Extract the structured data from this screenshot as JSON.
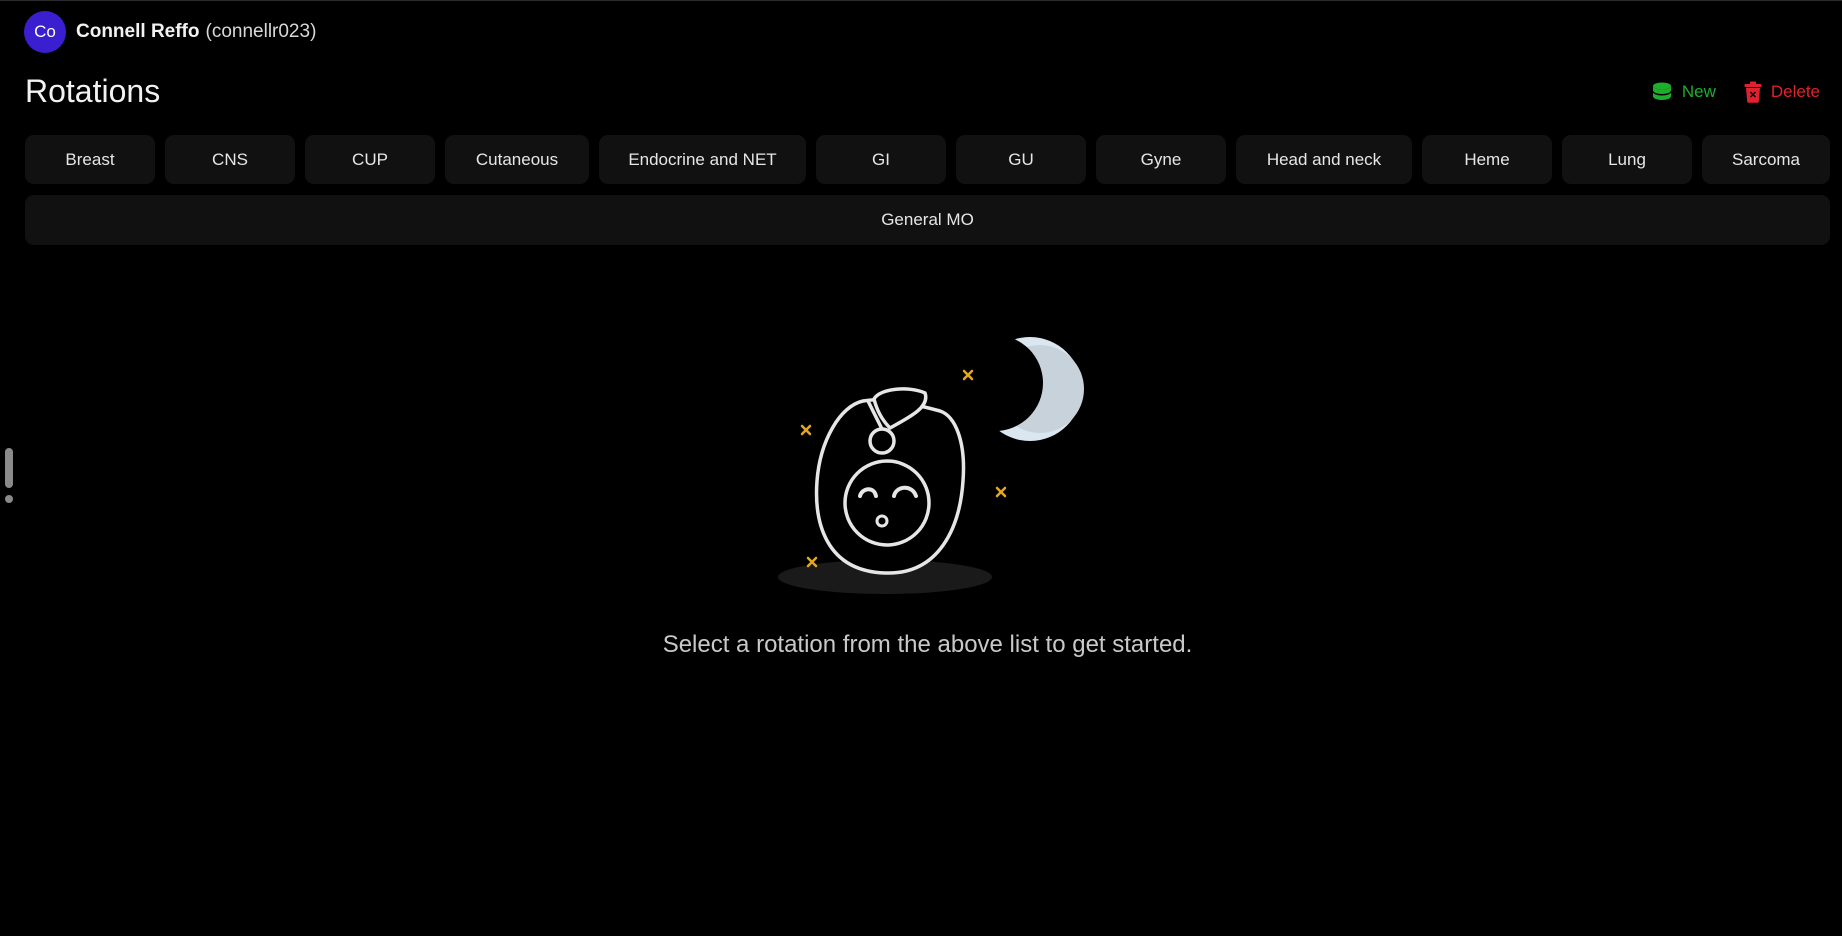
{
  "user": {
    "avatar_initials": "Co",
    "name": "Connell Reffo",
    "handle": "(connellr023)"
  },
  "page": {
    "title": "Rotations"
  },
  "actions": {
    "new_label": "New",
    "delete_label": "Delete",
    "new_icon": "database-icon",
    "delete_icon": "trash-icon"
  },
  "tabs": [
    {
      "label": "Breast"
    },
    {
      "label": "CNS"
    },
    {
      "label": "CUP"
    },
    {
      "label": "Cutaneous"
    },
    {
      "label": "Endocrine and NET"
    },
    {
      "label": "GI"
    },
    {
      "label": "GU"
    },
    {
      "label": "Gyne"
    },
    {
      "label": "Head and neck"
    },
    {
      "label": "Heme"
    },
    {
      "label": "Lung"
    },
    {
      "label": "Sarcoma"
    }
  ],
  "general_tab": {
    "label": "General MO"
  },
  "empty_state": {
    "message": "Select a rotation from the above list to get started.",
    "illustration": "sleeping-character-with-moon"
  },
  "colors": {
    "background": "#000000",
    "tab_background": "#111111",
    "avatar": "#3a1fd1",
    "new_action": "#1cae2c",
    "delete_action": "#e0212e",
    "sparkle": "#e3a81c",
    "moon": "#dbe7f0"
  }
}
